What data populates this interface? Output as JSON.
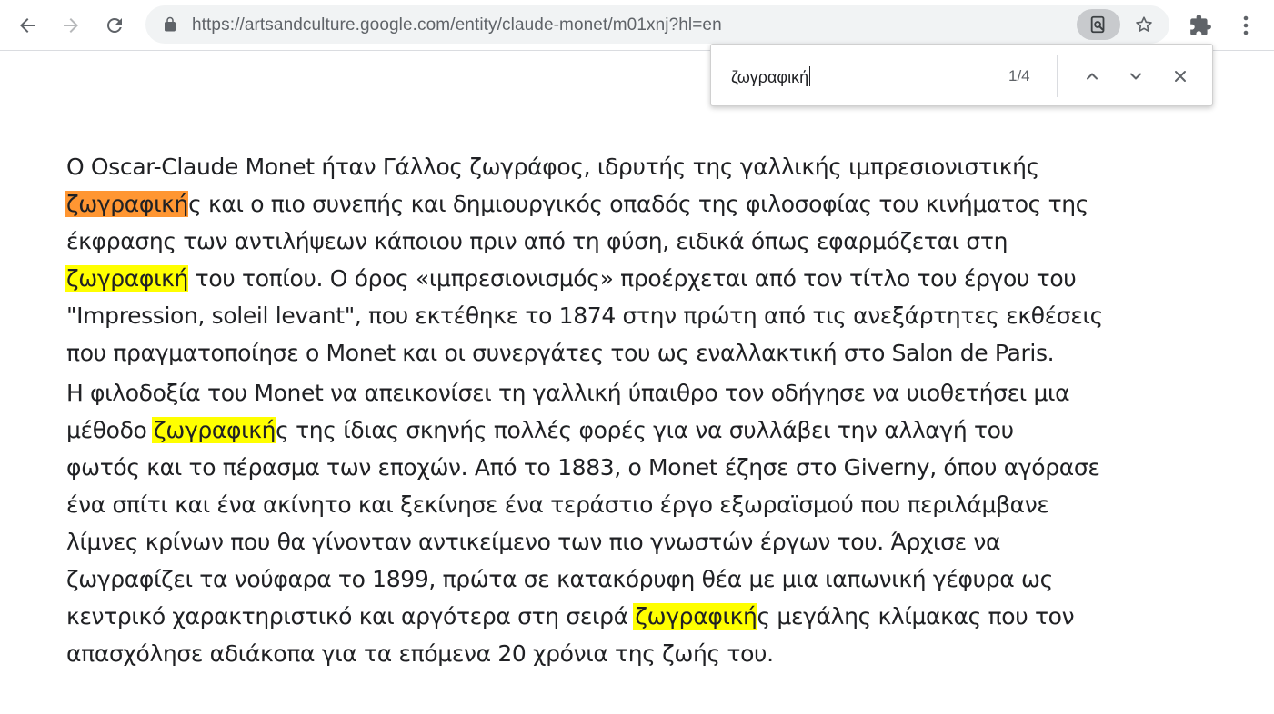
{
  "browser": {
    "url_host": "https://artsandculture.google.com",
    "url_path": "/entity/claude-monet/m01xnj?hl=en",
    "icons": {
      "back": "arrow-left-icon",
      "forward": "arrow-right-icon",
      "reload": "reload-icon",
      "lock": "lock-icon",
      "lens": "google-lens-icon",
      "bookmark": "star-icon",
      "extensions": "puzzle-icon",
      "menu": "more-vertical-icon"
    }
  },
  "find_bar": {
    "query": "ζωγραφική",
    "count": "1/4"
  },
  "article": {
    "paragraph1": [
      {
        "text": "Ο Oscar-Claude Monet ήταν Γάλλος ζωγράφος, ιδρυτής της γαλλικής ιμπρεσιονιστικής"
      },
      {
        "mark_active": "ζωγραφική",
        "rest": "ς και ο πιο συνεπής και δημιουργικός οπαδός της φιλοσοφίας του κινήματος της"
      },
      {
        "text": "έκφρασης των αντιλήψεων κάποιου πριν από τη φύση, ειδικά όπως εφαρμόζεται στη"
      },
      {
        "mark": "ζωγραφική",
        "rest": " του τοπίου. Ο όρος «ιμπρεσιονισμός» προέρχεται από τον τίτλο του έργου του"
      },
      {
        "text": "\"Impression, soleil levant\", που εκτέθηκε το 1874 στην πρώτη από τις ανεξάρτητες εκθέσεις"
      },
      {
        "text": "που πραγματοποίησε ο Monet και οι συνεργάτες του ως εναλλακτική στο Salon de Paris."
      }
    ],
    "paragraph2": [
      {
        "text": "Η φιλοδοξία του Monet να απεικονίσει τη γαλλική ύπαιθρο τον οδήγησε να υιοθετήσει μια"
      },
      {
        "before": "μέθοδο ",
        "mark": "ζωγραφική",
        "rest": "ς της ίδιας σκηνής πολλές φορές για να συλλάβει την αλλαγή του"
      },
      {
        "text": "φωτός και το πέρασμα των εποχών. Από το 1883, ο Monet έζησε στο Giverny, όπου αγόρασε"
      },
      {
        "text": "ένα σπίτι και ένα ακίνητο και ξεκίνησε ένα τεράστιο έργο εξωραϊσμού που περιλάμβανε"
      },
      {
        "text": "λίμνες κρίνων που θα γίνονταν αντικείμενο των πιο γνωστών έργων του. Άρχισε να"
      },
      {
        "text": "ζωγραφίζει τα νούφαρα το 1899, πρώτα σε κατακόρυφη θέα με μια ιαπωνική γέφυρα ως"
      },
      {
        "before": "κεντρικό χαρακτηριστικό και αργότερα στη σειρά ",
        "mark": "ζωγραφική",
        "rest": "ς μεγάλης κλίμακας που τον"
      },
      {
        "text": "απασχόλησε αδιάκοπα για τα επόμενα 20 χρόνια της ζωής του."
      }
    ]
  }
}
